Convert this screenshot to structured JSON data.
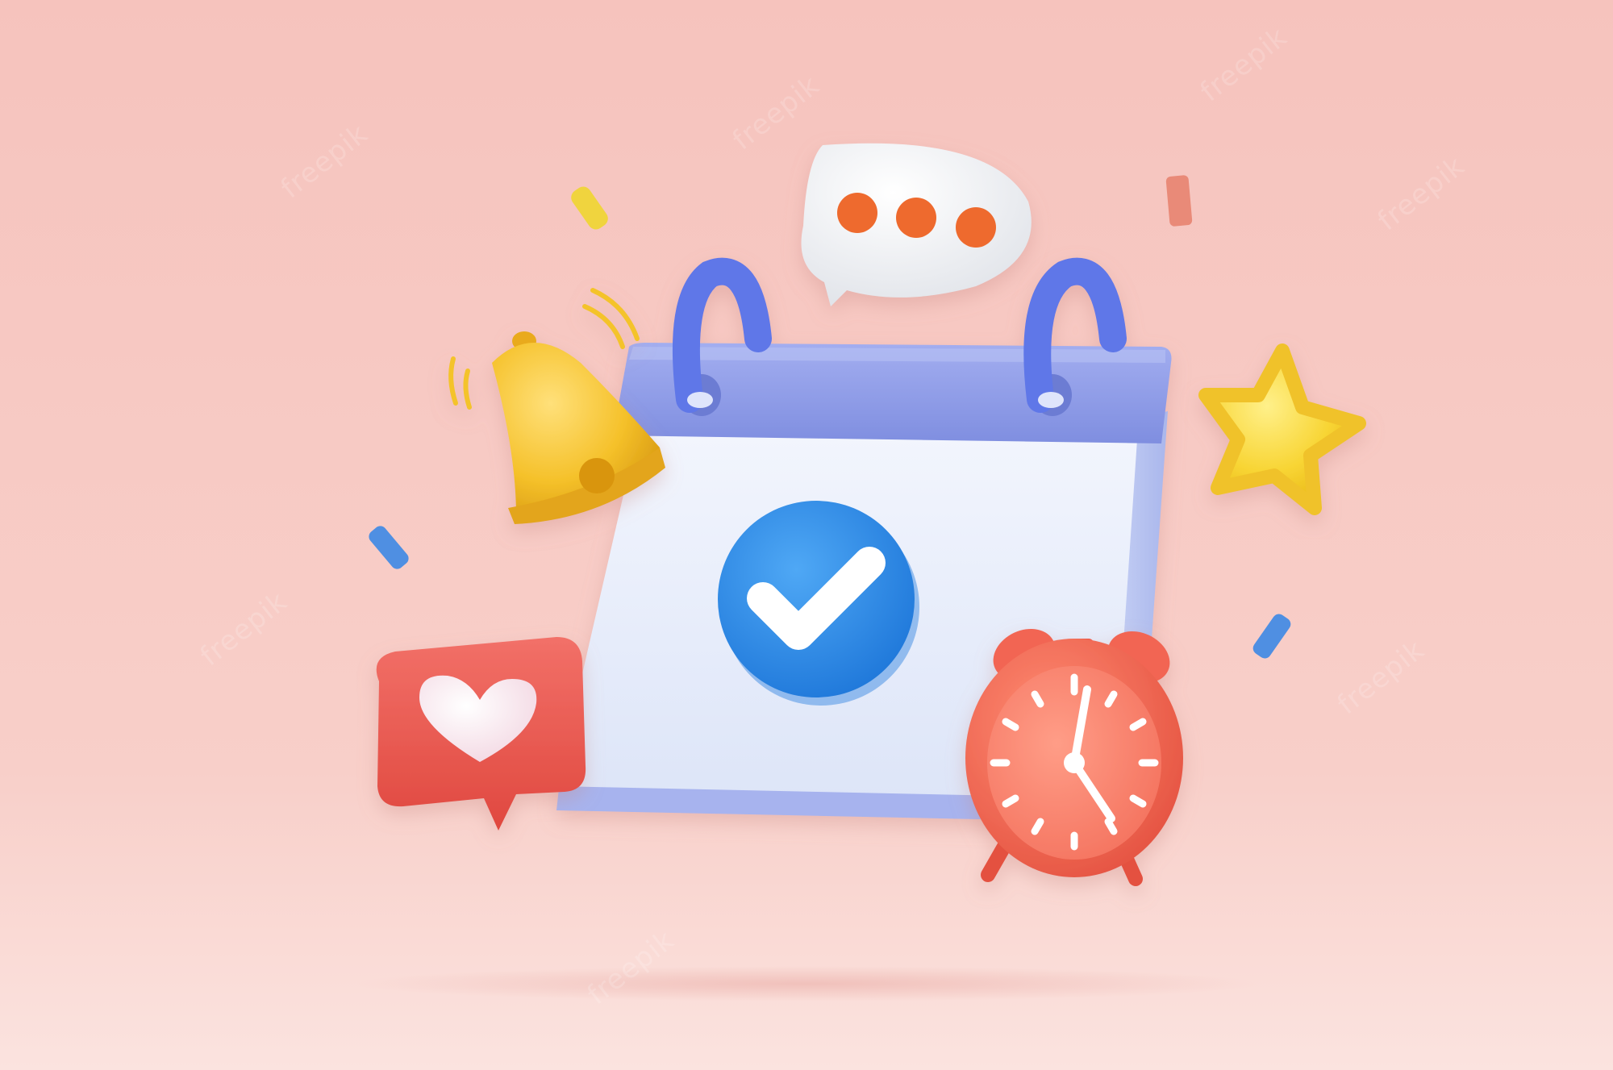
{
  "colors": {
    "background_top": "#f7c8c2",
    "background_bottom": "#fbe1dc",
    "calendar_header": "#8f9ce8",
    "calendar_page": "#e6ecfb",
    "check_circle": "#2f8fe8",
    "bell": "#f4c329",
    "star": "#f8d534",
    "heart_bubble": "#ef5f57",
    "clock": "#f4725e",
    "speech_bubble": "#eef0f3",
    "speech_dots": "#ee6a2e"
  },
  "icons": [
    "calendar-icon",
    "check-icon",
    "bell-icon",
    "speech-bubble-icon",
    "star-icon",
    "heart-bubble-icon",
    "alarm-clock-icon"
  ],
  "watermark": {
    "text": "freepik"
  }
}
